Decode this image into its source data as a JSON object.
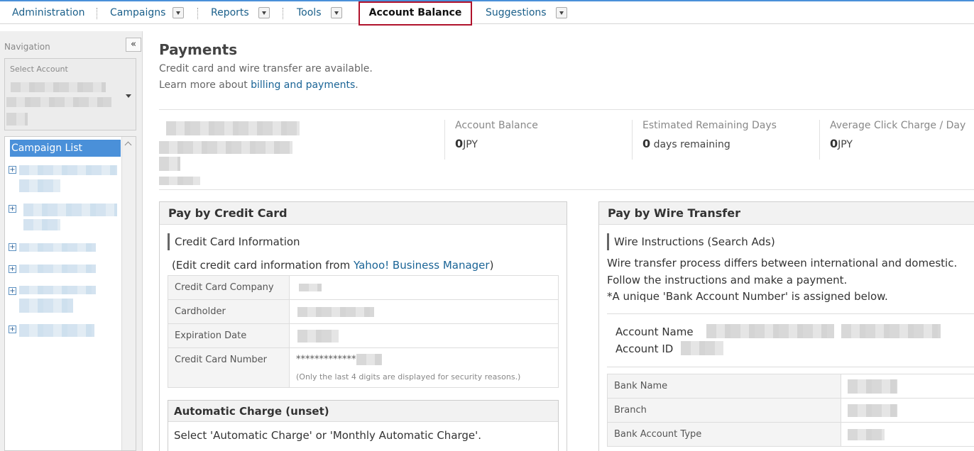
{
  "nav": {
    "administration": "Administration",
    "campaigns": "Campaigns",
    "reports": "Reports",
    "tools": "Tools",
    "account_balance": "Account Balance",
    "suggestions": "Suggestions"
  },
  "sidebar": {
    "navigation_label": "Navigation",
    "collapse_glyph": "«",
    "select_account_label": "Select Account",
    "campaign_list_label": "Campaign List"
  },
  "page": {
    "title": "Payments",
    "subtitle": "Credit card and wire transfer are available.",
    "learn_more_prefix": "Learn more about ",
    "learn_more_link": "billing and payments",
    "learn_more_suffix": "."
  },
  "summary": {
    "account_balance_label": "Account Balance",
    "account_balance_value": "0",
    "account_balance_unit": "JPY",
    "remaining_days_label": "Estimated Remaining Days",
    "remaining_days_value": "0",
    "remaining_days_unit": " days remaining",
    "avg_click_label": "Average Click Charge / Day",
    "avg_click_value": "0",
    "avg_click_unit": "JPY"
  },
  "credit": {
    "title": "Pay by Credit Card",
    "info_title": "Credit Card Information",
    "edit_prefix": "(Edit credit card information from ",
    "edit_link": "Yahoo! Business Manager",
    "edit_suffix": ")",
    "rows": {
      "company": "Credit Card Company",
      "holder": "Cardholder",
      "expiry": "Expiration Date",
      "number": "Credit Card Number"
    },
    "number_mask": "*************",
    "number_note": "(Only the last 4 digits are displayed for security reasons.)",
    "auto_title": "Automatic Charge (unset)",
    "auto_text": "Select 'Automatic Charge' or 'Monthly Automatic Charge'."
  },
  "wire": {
    "title": "Pay by Wire Transfer",
    "instructions_title": "Wire Instructions (Search Ads)",
    "line1": "Wire transfer process differs between international and domestic.",
    "line2": "Follow the instructions and make a payment.",
    "line3": "*A unique 'Bank Account Number' is assigned below.",
    "account_name_label": "Account Name",
    "account_id_label": "Account ID",
    "rows": {
      "bank_name": "Bank Name",
      "branch": "Branch",
      "account_type": "Bank Account Type"
    }
  }
}
